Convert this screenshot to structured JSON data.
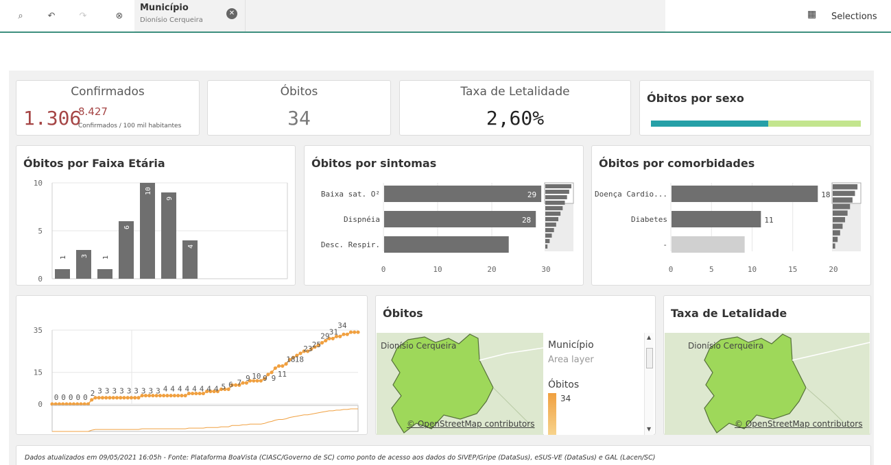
{
  "toolbar": {
    "icons": [
      "smart-search-icon",
      "step-back-icon",
      "step-forward-icon",
      "clear-selections-icon"
    ],
    "selection": {
      "field": "Município",
      "value": "Dionísio Cerqueira"
    },
    "selections_label": "Selections"
  },
  "kpis": {
    "confirmados": {
      "label": "Confirmados",
      "value": "1.306",
      "sup": "8.427",
      "sub": "Confirmados / 100 mil habitantes"
    },
    "obitos": {
      "label": "Óbitos",
      "value": "34"
    },
    "taxa": {
      "label": "Taxa de Letalidade",
      "value": "2,60%"
    },
    "sexo": {
      "title": "Óbitos por sexo",
      "shares": [
        0.56,
        0.44
      ],
      "colors": [
        "#26a0a7",
        "#c3e58e"
      ]
    }
  },
  "faixa": {
    "title": "Óbitos por Faixa Etária",
    "chart_data": {
      "type": "bar",
      "values": [
        1,
        3,
        1,
        6,
        10,
        9,
        4
      ],
      "ylim": [
        0,
        10
      ],
      "yticks": [
        "0",
        "5",
        "10"
      ],
      "labels": [
        "1",
        "3",
        "1",
        "6",
        "10",
        "9",
        "4"
      ]
    }
  },
  "sintomas": {
    "title": "Óbitos por sintomas",
    "chart_data": {
      "type": "bar",
      "categories": [
        "Baixa sat. O²",
        "Dispnéia",
        "Desc. Respir."
      ],
      "values": [
        29,
        28,
        23
      ],
      "labels": [
        "29",
        "28",
        ""
      ],
      "xlim": [
        0,
        30
      ],
      "xticks": [
        "0",
        "10",
        "20",
        "30"
      ]
    }
  },
  "comorbidades": {
    "title": "Óbitos por comorbidades",
    "chart_data": {
      "type": "bar",
      "categories": [
        "Doença Cardio...",
        "Diabetes",
        "-"
      ],
      "values": [
        18,
        11,
        9
      ],
      "labels": [
        "18",
        "11",
        ""
      ],
      "xlim": [
        0,
        20
      ],
      "xticks": [
        "0",
        "5",
        "10",
        "15",
        "20"
      ]
    }
  },
  "timeline": {
    "chart_data": {
      "type": "line",
      "yticks": [
        "0",
        "15",
        "35"
      ],
      "ylim": [
        0,
        35
      ],
      "values": [
        0,
        0,
        0,
        0,
        0,
        0,
        0,
        0,
        0,
        0,
        0,
        2,
        3,
        3,
        3,
        3,
        3,
        3,
        3,
        3,
        3,
        3,
        3,
        3,
        3,
        4,
        4,
        4,
        4,
        4,
        4,
        4,
        4,
        4,
        4,
        4,
        4,
        4,
        5,
        5,
        5,
        5,
        5,
        6,
        6,
        6,
        6,
        7,
        7,
        7,
        9,
        9,
        9,
        10,
        10,
        11,
        11,
        11,
        11,
        12,
        14,
        15,
        17,
        18,
        18,
        19,
        21,
        22,
        23,
        24,
        25,
        25,
        26,
        27,
        28,
        29,
        30,
        31,
        31,
        32,
        32,
        33,
        33,
        34,
        34,
        34
      ],
      "annotations": [
        "0",
        "0",
        "0",
        "0",
        "0",
        "2",
        "3",
        "3",
        "3",
        "3",
        "3",
        "3",
        "3",
        "3",
        "3",
        "4",
        "4",
        "4",
        "4",
        "4",
        "4",
        "4",
        "4",
        "5",
        "6",
        "7",
        "9",
        "10",
        "9",
        "9",
        "11",
        "18",
        "18",
        "23",
        "25",
        "29",
        "31",
        "34"
      ]
    }
  },
  "map_obitos": {
    "title": "Óbitos",
    "label": "Dionísio Cerqueira",
    "legend_title": "Município",
    "legend_sub": "Area layer",
    "legend_measure": "Óbitos",
    "legend_value": "34",
    "credit": "© OpenStreetMap contributors"
  },
  "map_taxa": {
    "title": "Taxa de Letalidade",
    "label": "Dionísio Cerqueira",
    "credit": "© OpenStreetMap contributors"
  },
  "footer": {
    "text": "Dados atualizados em 09/05/2021 16:05h - Fonte: Plataforma BoaVista (CIASC/Governo de SC) como ponto de acesso aos dados do SIVEP/Gripe (DataSus), eSUS-VE (DataSus) e GAL (Lacen/SC)"
  },
  "colors": {
    "bar": "#6f6f6f",
    "orange": "#f0a040",
    "kpi_red": "#a54545",
    "map_fill": "#9ed85a"
  }
}
